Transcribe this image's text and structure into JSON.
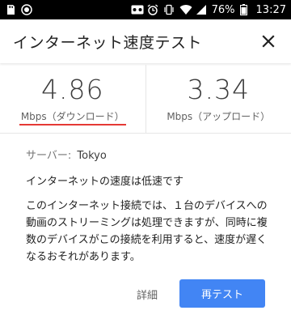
{
  "status_bar": {
    "battery": "76%",
    "time": "13:27",
    "left_icons": [
      "sd-card-icon",
      "record-icon"
    ],
    "right_icons": [
      "voicemail-icon",
      "alarm-icon",
      "vibrate-icon",
      "wifi-icon",
      "signal-icon",
      "battery-icon"
    ]
  },
  "header": {
    "title": "インターネット速度テスト",
    "close_icon": "close-icon"
  },
  "speeds": {
    "download": {
      "value": "4.86",
      "label": "Mbps（ダウンロード）"
    },
    "upload": {
      "value": "3.34",
      "label": "Mbps（アップロード）"
    }
  },
  "server": {
    "label": "サーバー:",
    "value": "Tokyo"
  },
  "status_text": "インターネットの速度は低速です",
  "description": "このインターネット接続では、１台のデバイスへの動画のストリーミングは処理できますが、同時に複数のデバイスがこの接続を利用すると、速度が遅くなるおそれがあります。",
  "buttons": {
    "details": "詳細",
    "retest": "再テスト"
  },
  "colors": {
    "accent": "#4285f4",
    "underline": "#e53935"
  }
}
